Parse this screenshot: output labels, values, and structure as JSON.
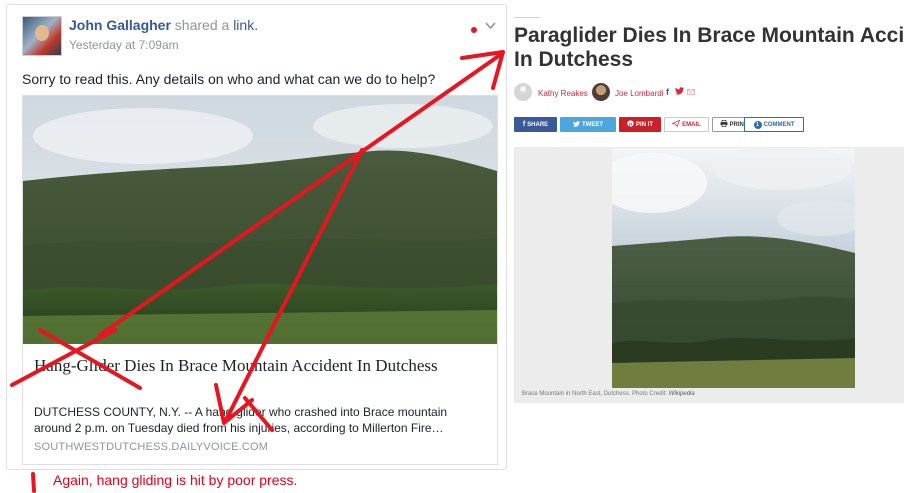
{
  "post": {
    "author": "John Gallagher",
    "action_text": " shared a ",
    "link_word": "link.",
    "timestamp": "Yesterday at 7:09am",
    "message": "Sorry to read this. Any details on who and what can we do to help?",
    "card": {
      "title": "Hang-Glider Dies In Brace Mountain Accident In Dutchess",
      "description": "DUTCHESS COUNTY, N.Y. -- A hang-glider who crashed into Brace mountain around 2 p.m. on Tuesday died from his injuries, according to Millerton Fire…",
      "domain": "SOUTHWESTDUTCHESS.DAILYVOICE.COM"
    }
  },
  "annotation": {
    "caption": "Again, hang gliding is hit by poor press.",
    "color": "#e3001b"
  },
  "article": {
    "title_line1": "Paraglider Dies In Brace Mountain Accide",
    "title_line2": "In Dutchess",
    "author1": "Kathy Reakes",
    "author2": "Joe Lombardi",
    "share_buttons": {
      "facebook": "SHARE",
      "twitter": "TWEET",
      "pinterest": "PIN IT",
      "email": "EMAIL",
      "print": "PRINT",
      "comment": "COMMENT",
      "comment_count": "1"
    },
    "photo_caption_prefix": "Brace Mountain in North East, Dutchess. Photo Credit: ",
    "photo_credit": "Wikipedia"
  },
  "colors": {
    "facebook_blue": "#365899",
    "accent_red": "#d9253a"
  },
  "icons": {
    "chevron": "chevron-down-icon",
    "facebook": "facebook-icon",
    "twitter": "twitter-icon",
    "pinterest": "pinterest-icon",
    "email": "email-icon",
    "print": "print-icon"
  }
}
